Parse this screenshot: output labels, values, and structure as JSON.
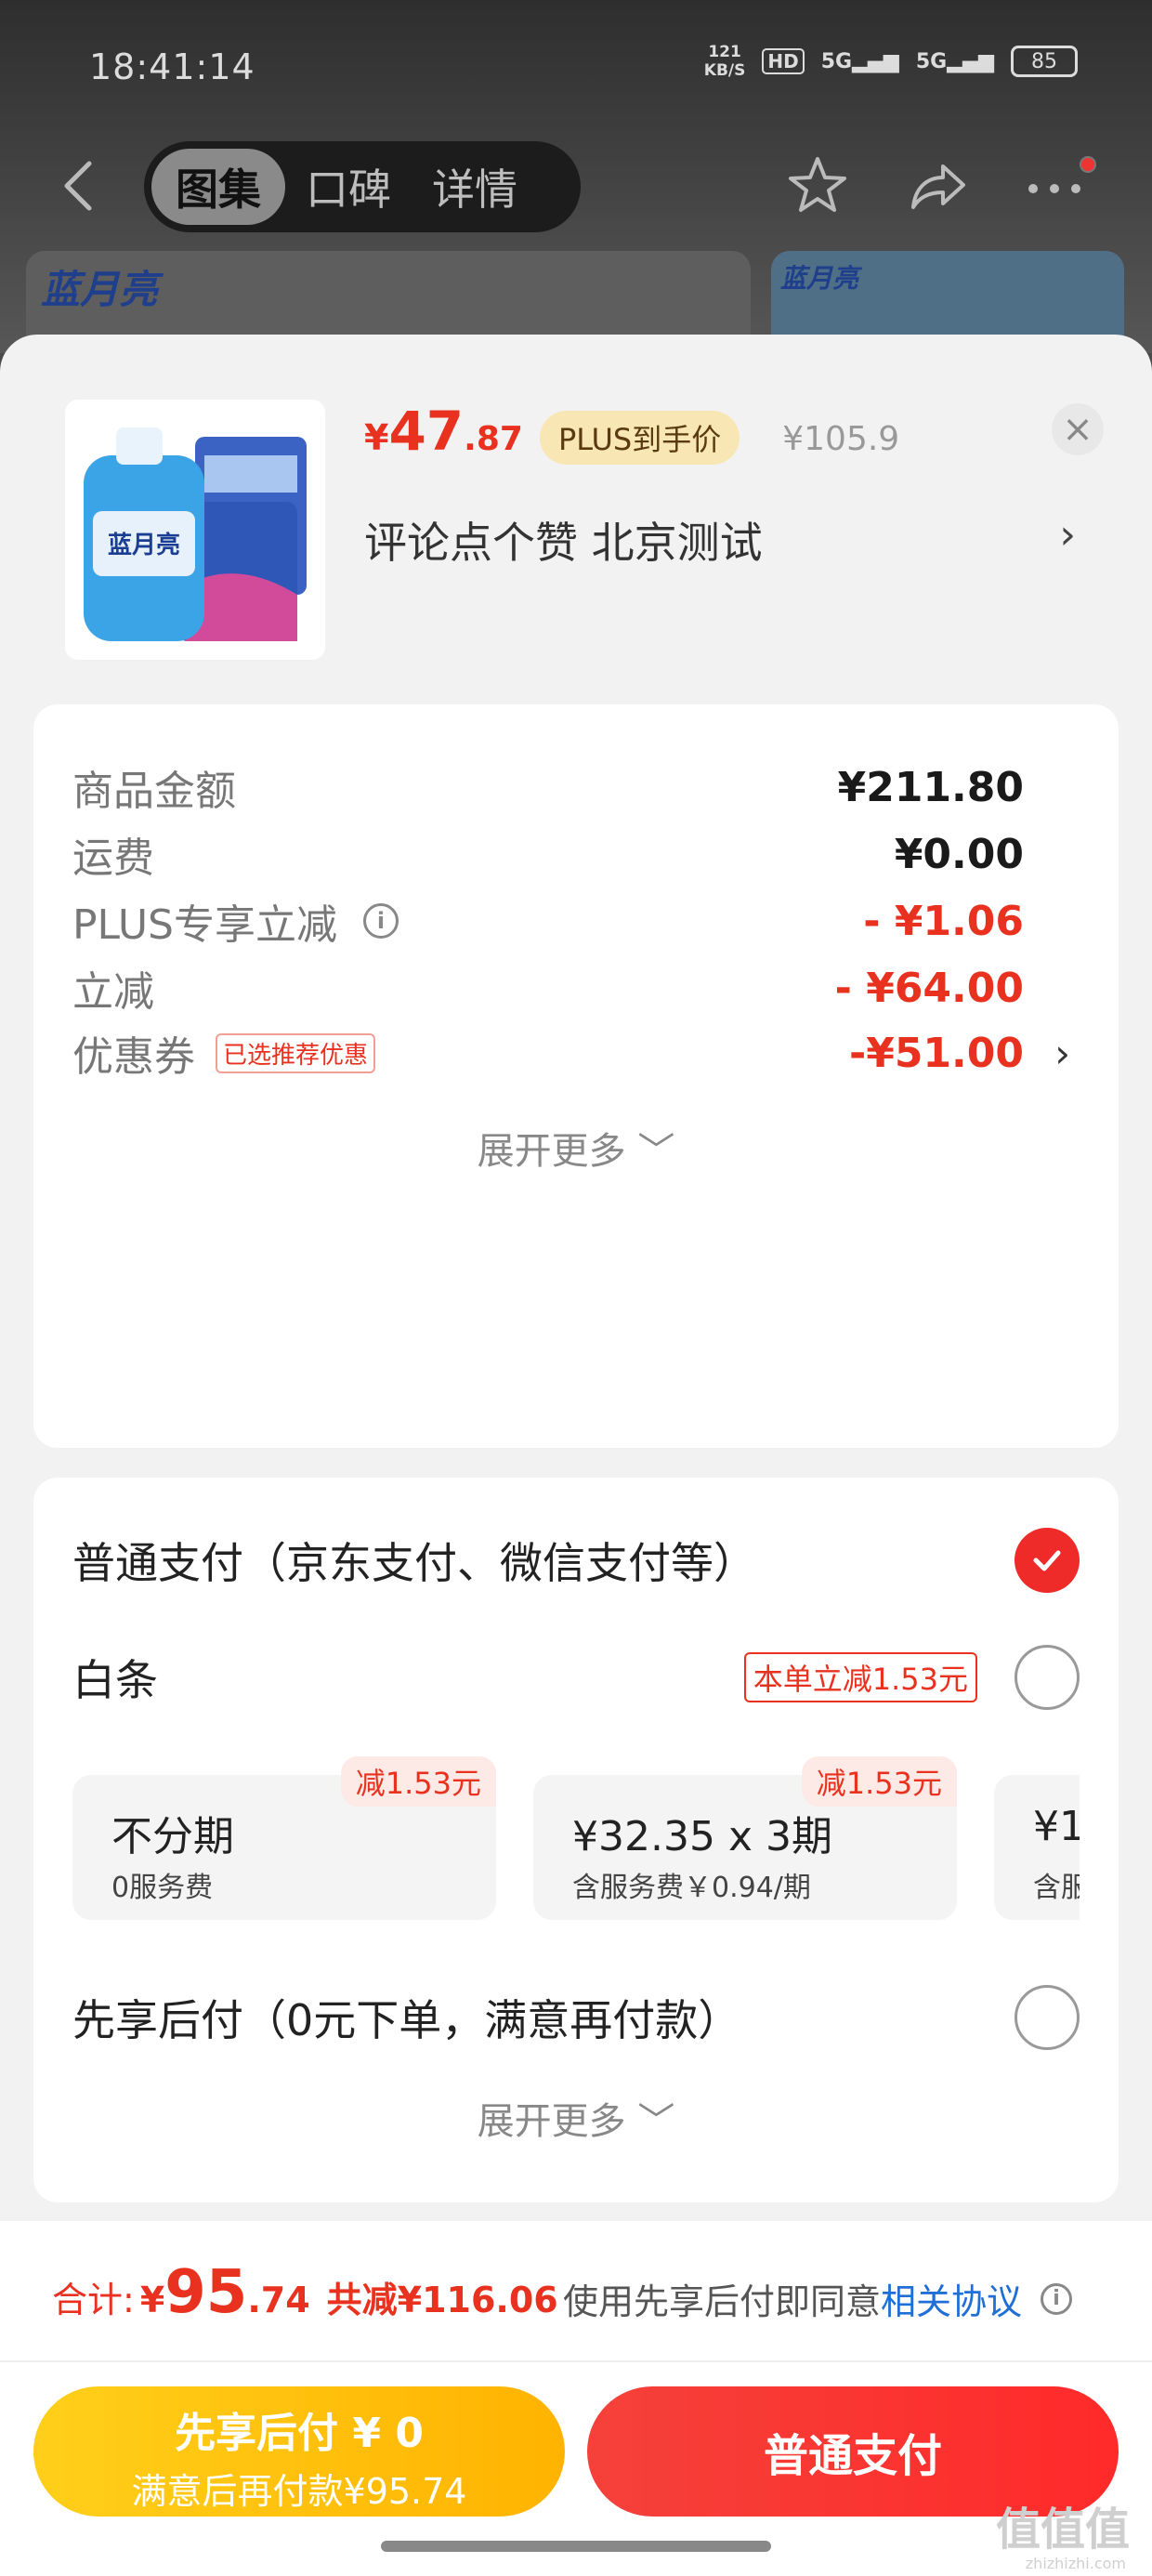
{
  "status": {
    "time": "18:41:14",
    "net_speed_value": "121",
    "net_speed_unit": "KB/S",
    "hd": "HD",
    "signal1": "5G",
    "signal2": "5G",
    "battery": "85"
  },
  "nav": {
    "tabs": [
      {
        "label": "图集"
      },
      {
        "label": "口碑"
      },
      {
        "label": "详情"
      }
    ],
    "brand": "蓝月亮",
    "brand_right": "蓝月亮"
  },
  "product": {
    "price_symbol": "¥",
    "price_int": "47",
    "price_dec": ".87",
    "plus_badge": "PLUS到手价",
    "orig_price": "¥105.9",
    "subtitle": "评论点个赞  北京测试",
    "chevron": "›",
    "close": "×"
  },
  "summary": {
    "rows": [
      {
        "label": "商品金额",
        "value": "¥211.80"
      },
      {
        "label": "运费",
        "value": "¥0.00"
      },
      {
        "label": "PLUS专享立减",
        "value": "- ¥1.06"
      },
      {
        "label": "立减",
        "value": "- ¥64.00"
      },
      {
        "label": "优惠券",
        "value": "-¥51.00",
        "tag": "已选推荐优惠"
      }
    ],
    "expand": "展开更多 ﹀"
  },
  "payment": {
    "normal": "普通支付（京东支付、微信支付等）",
    "baitiao": "白条",
    "baitiao_tag": "本单立减1.53元",
    "installments": [
      {
        "title": "不分期",
        "sub": "0服务费",
        "flag": "减1.53元"
      },
      {
        "title": "¥32.35 x 3期",
        "sub": "含服务费￥0.94/期",
        "flag": "减1.53元"
      },
      {
        "title": "¥1",
        "sub": "含服"
      }
    ],
    "later": "先享后付（0元下单，满意再付款）",
    "expand": "展开更多 ﹀"
  },
  "footer": {
    "total_label": "合计:",
    "total_symbol": "¥",
    "total_int": "95",
    "total_dec": ".74",
    "saved": "共减¥116.06",
    "agree_text": "使用先享后付即同意",
    "agree_link": "相关协议",
    "btn_later_l1": "先享后付 ¥ 0",
    "btn_later_l2": "满意后再付款¥95.74",
    "btn_pay": "普通支付"
  },
  "watermark": {
    "big": "值值值",
    "small": "zhizhizhi.com"
  },
  "colors": {
    "accent_red": "#e8321f",
    "button_yellow": "#ffb300",
    "link_blue": "#1f6fd6"
  }
}
